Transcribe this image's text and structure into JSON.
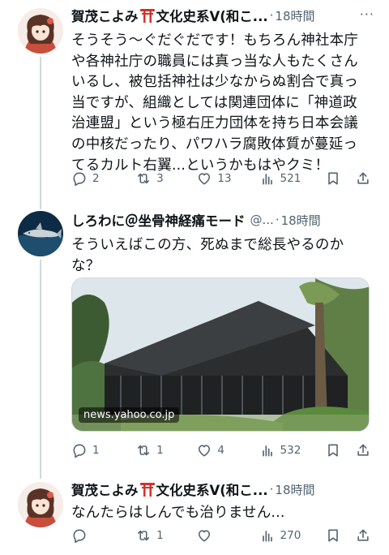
{
  "tweets": [
    {
      "name_part1": "賀茂こよみ",
      "name_part2": "文化史系V(和こ...",
      "time": "18時間",
      "text": "そうそう〜ぐだぐだです！もちろん神社本庁\nや各神社庁の職員には真っ当な人もたくさん\nいるし、被包括神社は少なからぬ割合で真っ\n当ですが、組織としては関連団体に「神道政\n治連盟」という極右圧力団体を持ち日本会議\nの中核だったり、パワハラ腐敗体質が蔓延っ\nてるカルト右翼...というかもはやクミ！",
      "replies": "2",
      "reposts": "3",
      "likes": "13",
      "views": "521"
    },
    {
      "name": "しろわに＠坐骨神経痛モード",
      "handle": "@...",
      "time": "18時間",
      "text": "そういえばこの方、死ぬまで総長やるのか\nな？",
      "card_domain": "news.yahoo.co.jp",
      "replies": "1",
      "reposts": "1",
      "likes": "4",
      "views": "532"
    },
    {
      "name_part1": "賀茂こよみ",
      "name_part2": "文化史系V(和こ...",
      "time": "18時間",
      "text": "なんたらはしんでも治りません...",
      "replies": "",
      "reposts": "1",
      "likes": "",
      "views": "270"
    }
  ],
  "sep": "·",
  "more_glyph": "···",
  "icons": [
    "reply-icon",
    "repost-icon",
    "like-icon",
    "views-icon",
    "bookmark-icon",
    "share-icon",
    "torii-icon",
    "more-icon"
  ],
  "colors": {
    "secondary_text": "#536471",
    "torii_red": "#d3312b",
    "thread_line": "#cfd9de"
  }
}
